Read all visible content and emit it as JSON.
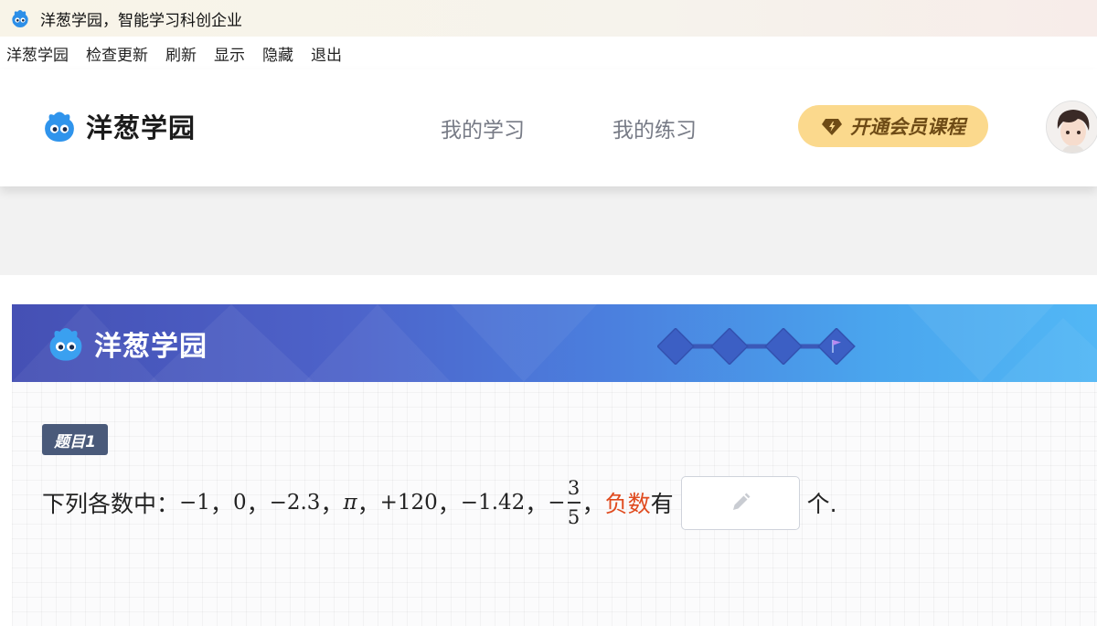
{
  "window": {
    "title": "洋葱学园，智能学习科创企业",
    "icon": "onion-app-icon"
  },
  "menubar": {
    "items": [
      "洋葱学园",
      "检查更新",
      "刷新",
      "显示",
      "隐藏",
      "退出"
    ]
  },
  "header": {
    "brand": "洋葱学园",
    "nav": [
      "我的学习",
      "我的练习"
    ],
    "vip_button": "开通会员课程",
    "avatar": "user-avatar"
  },
  "banner": {
    "brand": "洋葱学园",
    "progress": {
      "total": 4,
      "current": 4,
      "icon": "flag-icon"
    }
  },
  "question": {
    "badge": "题目1",
    "prefix": "下列各数中：",
    "numbers": [
      "−1",
      "0",
      "−2.3",
      "π",
      "+120",
      "−1.42"
    ],
    "separator": "，",
    "fraction": {
      "sign": "−",
      "numerator": "3",
      "denominator": "5"
    },
    "highlight": "负数",
    "mid": "有",
    "answer_value": "",
    "suffix": "个."
  },
  "colors": {
    "accent": "#e04b1f",
    "vip_bg": "#fbd98d",
    "banner_start": "#4550b4",
    "banner_end": "#52b7f5",
    "badge_bg": "#4a5a7a"
  }
}
